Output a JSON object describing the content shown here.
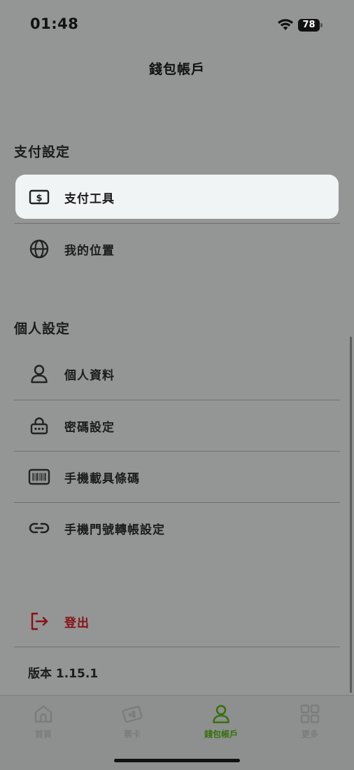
{
  "status": {
    "time": "01:48",
    "battery": "78"
  },
  "header": {
    "title": "錢包帳戶"
  },
  "payment_section": {
    "heading": "支付設定",
    "items": [
      {
        "label": "支付工具",
        "icon": "cash-icon"
      },
      {
        "label": "我的位置",
        "icon": "globe-icon"
      }
    ]
  },
  "personal_section": {
    "heading": "個人設定",
    "items": [
      {
        "label": "個人資料",
        "icon": "person-icon"
      },
      {
        "label": "密碼設定",
        "icon": "password-icon"
      },
      {
        "label": "手機載具條碼",
        "icon": "barcode-icon"
      },
      {
        "label": "手機門號轉帳設定",
        "icon": "link-icon"
      }
    ]
  },
  "logout": {
    "label": "登出",
    "icon": "logout-icon",
    "color": "#8a0f16"
  },
  "version": {
    "text": "版本 1.15.1"
  },
  "tab_bar": {
    "tabs": [
      {
        "label": "首頁",
        "icon": "home-icon",
        "active": false
      },
      {
        "label": "票卡",
        "icon": "card-icon",
        "active": false
      },
      {
        "label": "錢包帳戶",
        "icon": "person-icon",
        "active": true
      },
      {
        "label": "更多",
        "icon": "grid-icon",
        "active": false
      }
    ],
    "active_color": "#3a7010",
    "inactive_color": "#7a7d7c"
  }
}
